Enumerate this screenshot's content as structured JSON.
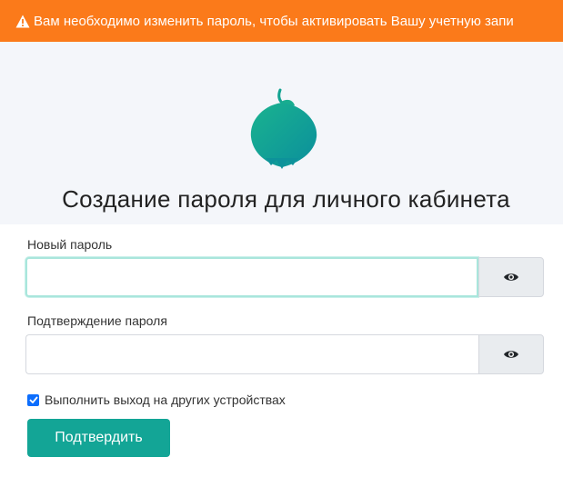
{
  "alert": {
    "icon": "warning-triangle-icon",
    "text": "Вам необходимо изменить пароль, чтобы активировать Вашу учетную запи",
    "color": "#fb7a1a"
  },
  "header": {
    "logo_icon": "onion-leaf-logo",
    "title": "Создание пароля для личного кабинета"
  },
  "form": {
    "new_password": {
      "label": "Новый пароль",
      "value": "",
      "toggle_icon": "eye-icon"
    },
    "confirm_password": {
      "label": "Подтверждение пароля",
      "value": "",
      "toggle_icon": "eye-icon"
    },
    "logout_others": {
      "label": "Выполнить выход на других устройствах",
      "checked": true
    },
    "submit_label": "Подтвердить"
  },
  "colors": {
    "accent": "#13a596",
    "checkbox": "#0d6efd",
    "focus_border": "#a9e6dc"
  }
}
